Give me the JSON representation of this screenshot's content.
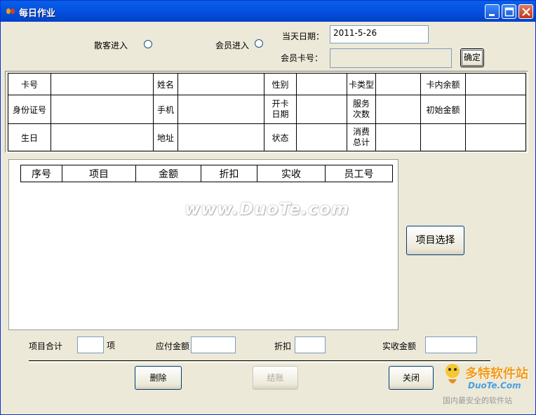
{
  "window": {
    "title": "每日作业"
  },
  "entry": {
    "walkin_label": "散客进入",
    "member_label": "会员进入",
    "date_label": "当天日期：",
    "date_value": "2011-5-26",
    "card_label": "会员卡号：",
    "card_value": "",
    "confirm_label": "确定"
  },
  "info": {
    "card_no": "卡号",
    "name": "姓名",
    "gender": "性别",
    "card_type": "卡类型",
    "balance": "卡内余额",
    "id_no": "身份证号",
    "phone": "手机",
    "open_date": "开卡\n日期",
    "service_count": "服务\n次数",
    "initial_amount": "初始金额",
    "birthday": "生日",
    "address": "地址",
    "status": "状态",
    "consume_total": "消费\n总计"
  },
  "grid": {
    "columns": [
      "序号",
      "项目",
      "金额",
      "折扣",
      "实收",
      "员工号"
    ]
  },
  "select_item_label": "项目选择",
  "summary": {
    "item_total_label": "项目合计",
    "item_unit": "项",
    "payable_label": "应付金额",
    "discount_label": "折扣",
    "actual_label": "实收金额"
  },
  "buttons": {
    "delete": "删除",
    "checkout": "结账",
    "close": "关闭"
  },
  "watermark": {
    "site": "www.DuoTe.com",
    "logo_text": "多特软件站",
    "logo_domain": "DuoTe.Com",
    "slogan": "国内最安全的软件站"
  }
}
